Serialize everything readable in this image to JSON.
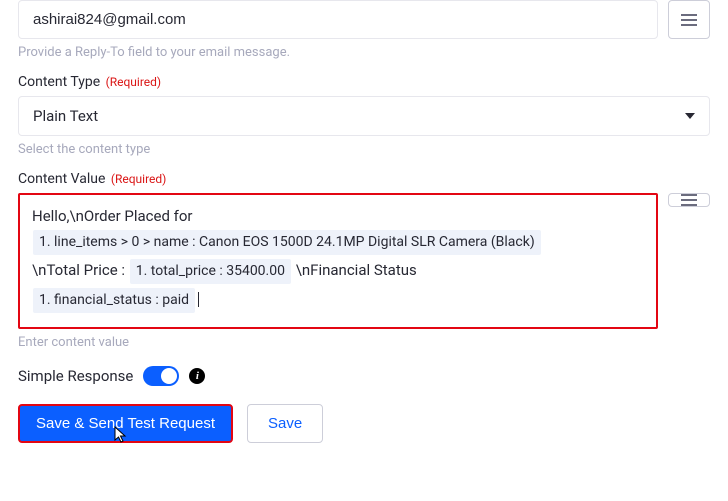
{
  "replyTo": {
    "value": "ashirai824@gmail.com",
    "help": "Provide a Reply-To field to your email message."
  },
  "contentType": {
    "label": "Content Type",
    "required": "(Required)",
    "value": "Plain Text",
    "help": "Select the content type"
  },
  "contentValue": {
    "label": "Content Value",
    "required": "(Required)",
    "text1": "Hello,\\nOrder Placed for",
    "chip1": "1. line_items > 0 > name : Canon EOS 1500D 24.1MP Digital SLR Camera (Black)",
    "text2": "\\nTotal Price : ",
    "chip2": "1. total_price : 35400.00",
    "text3": " \\nFinancial Status",
    "chip3": "1. financial_status : paid",
    "help": "Enter content value"
  },
  "simpleResponse": {
    "label": "Simple Response",
    "on": true
  },
  "buttons": {
    "primary": "Save & Send Test Request",
    "secondary": "Save"
  }
}
